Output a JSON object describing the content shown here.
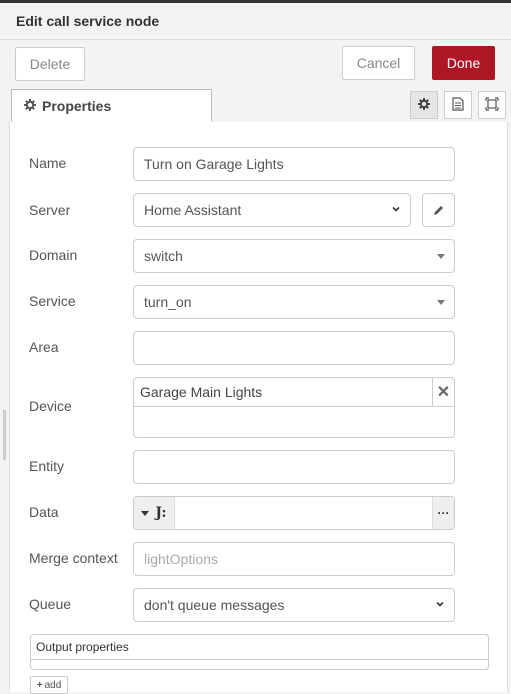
{
  "header": {
    "title": "Edit call service node"
  },
  "toolbar": {
    "delete_label": "Delete",
    "cancel_label": "Cancel",
    "done_label": "Done"
  },
  "tabs": {
    "properties_label": "Properties"
  },
  "form": {
    "name": {
      "label": "Name",
      "value": "Turn on Garage Lights"
    },
    "server": {
      "label": "Server",
      "value": "Home Assistant"
    },
    "domain": {
      "label": "Domain",
      "value": "switch"
    },
    "service": {
      "label": "Service",
      "value": "turn_on"
    },
    "area": {
      "label": "Area",
      "value": ""
    },
    "device": {
      "label": "Device",
      "selected": "Garage Main Lights"
    },
    "entity": {
      "label": "Entity",
      "value": ""
    },
    "data": {
      "label": "Data",
      "type_glyph": "J:",
      "more": "···"
    },
    "merge_context": {
      "label": "Merge context",
      "placeholder": "lightOptions"
    },
    "queue": {
      "label": "Queue",
      "value": "don't queue messages"
    },
    "output_properties": {
      "label": "Output properties",
      "add_label": "add"
    }
  },
  "colors": {
    "done_button": "#ad1625"
  }
}
